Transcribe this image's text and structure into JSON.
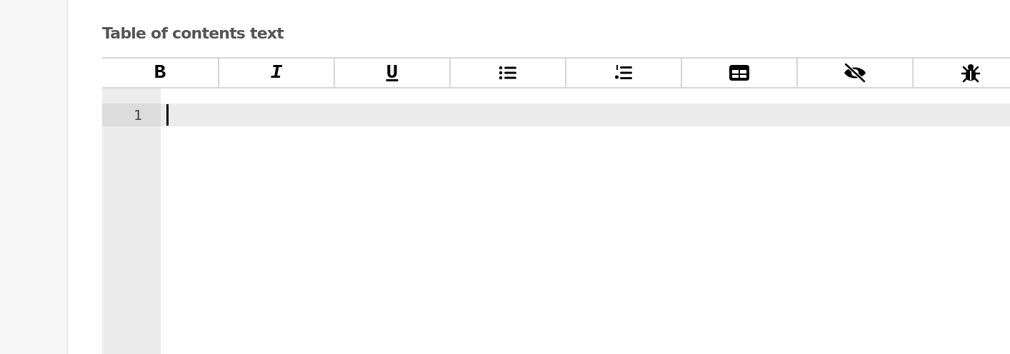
{
  "field": {
    "label": "Table of contents text"
  },
  "toolbar": [
    {
      "kind": "bold",
      "label": "B"
    },
    {
      "kind": "italic",
      "label": "I"
    },
    {
      "kind": "underline",
      "label": "U"
    },
    {
      "kind": "bullets"
    },
    {
      "kind": "numbers"
    },
    {
      "kind": "table"
    },
    {
      "kind": "preview"
    },
    {
      "kind": "debug"
    }
  ],
  "editor": {
    "lines": [
      {
        "number": "1",
        "active": true
      }
    ]
  }
}
